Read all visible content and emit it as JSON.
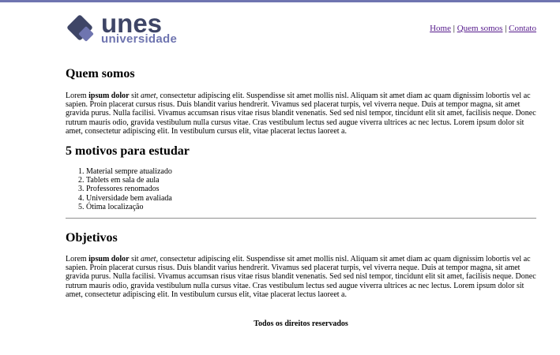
{
  "logo": {
    "brand": "unes",
    "subtitle": "universidade",
    "colors": {
      "dark": "#3e4566",
      "accent": "#6f75b0"
    }
  },
  "nav": {
    "items": [
      "Home",
      "Quem somos",
      "Contato"
    ],
    "separator": "|"
  },
  "sections": {
    "about": {
      "title": "Quem somos",
      "p_lead": "Lorem ",
      "p_bold": "ipsum dolor",
      "p_mid": " sit ",
      "p_italic": "amet",
      "p_rest": ", consectetur adipiscing elit. Suspendisse sit amet mollis nisl. Aliquam sit amet diam ac quam dignissim lobortis vel ac sapien. Proin placerat cursus risus. Duis blandit varius hendrerit. Vivamus sed placerat turpis, vel viverra neque. Duis at tempor magna, sit amet gravida purus. Nulla facilisi. Vivamus accumsan risus vitae risus blandit venenatis. Sed sed nisl tempor, tincidunt elit sit amet, facilisis neque. Donec rutrum mauris odio, gravida vestibulum nulla cursus vitae. Cras vestibulum lectus sed augue viverra ultrices ac nec lectus. Lorem ipsum dolor sit amet, consectetur adipiscing elit. In vestibulum cursus elit, vitae placerat lectus laoreet a."
    },
    "reasons": {
      "title": "5 motivos para estudar",
      "items": [
        "Material sempre atualizado",
        "Tablets em sala de aula",
        "Professores renomados",
        "Universidade bem avaliada",
        "Ótima localização"
      ]
    },
    "goals": {
      "title": "Objetivos",
      "p_lead": "Lorem ",
      "p_bold": "ipsum dolor",
      "p_mid": " sit ",
      "p_italic": "amet",
      "p_rest": ", consectetur adipiscing elit. Suspendisse sit amet mollis nisl. Aliquam sit amet diam ac quam dignissim lobortis vel ac sapien. Proin placerat cursus risus. Duis blandit varius hendrerit. Vivamus sed placerat turpis, vel viverra neque. Duis at tempor magna, sit amet gravida purus. Nulla facilisi. Vivamus accumsan risus vitae risus blandit venenatis. Sed sed nisl tempor, tincidunt elit sit amet, facilisis neque. Donec rutrum mauris odio, gravida vestibulum nulla cursus vitae. Cras vestibulum lectus sed augue viverra ultrices ac nec lectus. Lorem ipsum dolor sit amet, consectetur adipiscing elit. In vestibulum cursus elit, vitae placerat lectus laoreet a."
    }
  },
  "footer": {
    "text": "Todos os direitos reservados"
  }
}
